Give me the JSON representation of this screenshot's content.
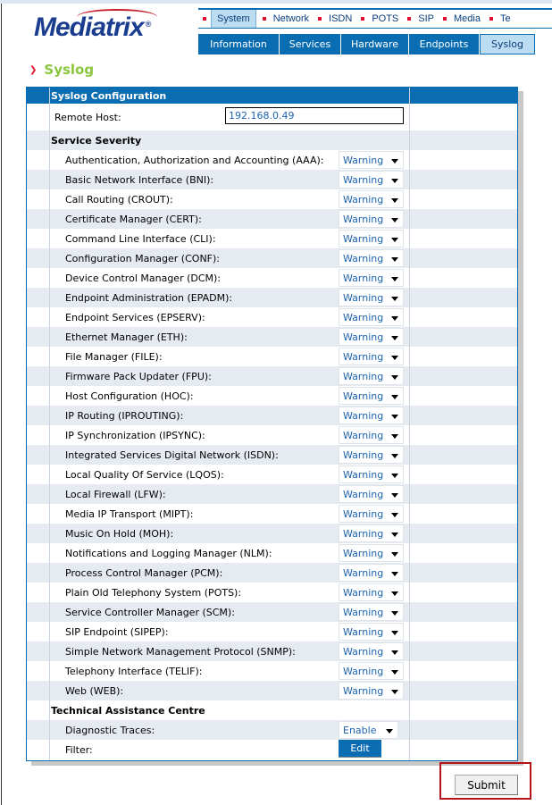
{
  "brand": {
    "logo_text": "Mediatrix"
  },
  "main_nav": [
    {
      "label": "System",
      "active": true
    },
    {
      "label": "Network"
    },
    {
      "label": "ISDN"
    },
    {
      "label": "POTS"
    },
    {
      "label": "SIP"
    },
    {
      "label": "Media"
    },
    {
      "label": "Te"
    }
  ],
  "sub_nav": [
    {
      "label": "Information"
    },
    {
      "label": "Services"
    },
    {
      "label": "Hardware"
    },
    {
      "label": "Endpoints"
    },
    {
      "label": "Syslog",
      "active": true
    }
  ],
  "page_title": "Syslog",
  "config": {
    "header": "Syslog Configuration",
    "remote_host_label": "Remote Host:",
    "remote_host_value": "192.168.0.49",
    "service_severity_header": "Service Severity",
    "services": [
      {
        "label": "Authentication, Authorization and Accounting (AAA):",
        "value": "Warning"
      },
      {
        "label": "Basic Network Interface (BNI):",
        "value": "Warning"
      },
      {
        "label": "Call Routing (CROUT):",
        "value": "Warning"
      },
      {
        "label": "Certificate Manager (CERT):",
        "value": "Warning"
      },
      {
        "label": "Command Line Interface (CLI):",
        "value": "Warning"
      },
      {
        "label": "Configuration Manager (CONF):",
        "value": "Warning"
      },
      {
        "label": "Device Control Manager (DCM):",
        "value": "Warning"
      },
      {
        "label": "Endpoint Administration (EPADM):",
        "value": "Warning"
      },
      {
        "label": "Endpoint Services (EPSERV):",
        "value": "Warning"
      },
      {
        "label": "Ethernet Manager (ETH):",
        "value": "Warning"
      },
      {
        "label": "File Manager (FILE):",
        "value": "Warning"
      },
      {
        "label": "Firmware Pack Updater (FPU):",
        "value": "Warning"
      },
      {
        "label": "Host Configuration (HOC):",
        "value": "Warning"
      },
      {
        "label": "IP Routing (IPROUTING):",
        "value": "Warning"
      },
      {
        "label": "IP Synchronization (IPSYNC):",
        "value": "Warning"
      },
      {
        "label": "Integrated Services Digital Network (ISDN):",
        "value": "Warning"
      },
      {
        "label": "Local Quality Of Service (LQOS):",
        "value": "Warning"
      },
      {
        "label": "Local Firewall (LFW):",
        "value": "Warning"
      },
      {
        "label": "Media IP Transport (MIPT):",
        "value": "Warning"
      },
      {
        "label": "Music On Hold (MOH):",
        "value": "Warning"
      },
      {
        "label": "Notifications and Logging Manager (NLM):",
        "value": "Warning"
      },
      {
        "label": "Process Control Manager (PCM):",
        "value": "Warning"
      },
      {
        "label": "Plain Old Telephony System (POTS):",
        "value": "Warning"
      },
      {
        "label": "Service Controller Manager (SCM):",
        "value": "Warning"
      },
      {
        "label": "SIP Endpoint (SIPEP):",
        "value": "Warning"
      },
      {
        "label": "Simple Network Management Protocol (SNMP):",
        "value": "Warning"
      },
      {
        "label": "Telephony Interface (TELIF):",
        "value": "Warning"
      },
      {
        "label": "Web (WEB):",
        "value": "Warning"
      }
    ],
    "tac_header": "Technical Assistance Centre",
    "diagnostic_traces_label": "Diagnostic Traces:",
    "diagnostic_traces_value": "Enable",
    "filter_label": "Filter:",
    "edit_label": "Edit"
  },
  "submit_label": "Submit",
  "colors": {
    "primary": "#0a6db1",
    "title": "#8cc63f",
    "accent_red": "#e0102a",
    "highlight": "#b5121b"
  }
}
